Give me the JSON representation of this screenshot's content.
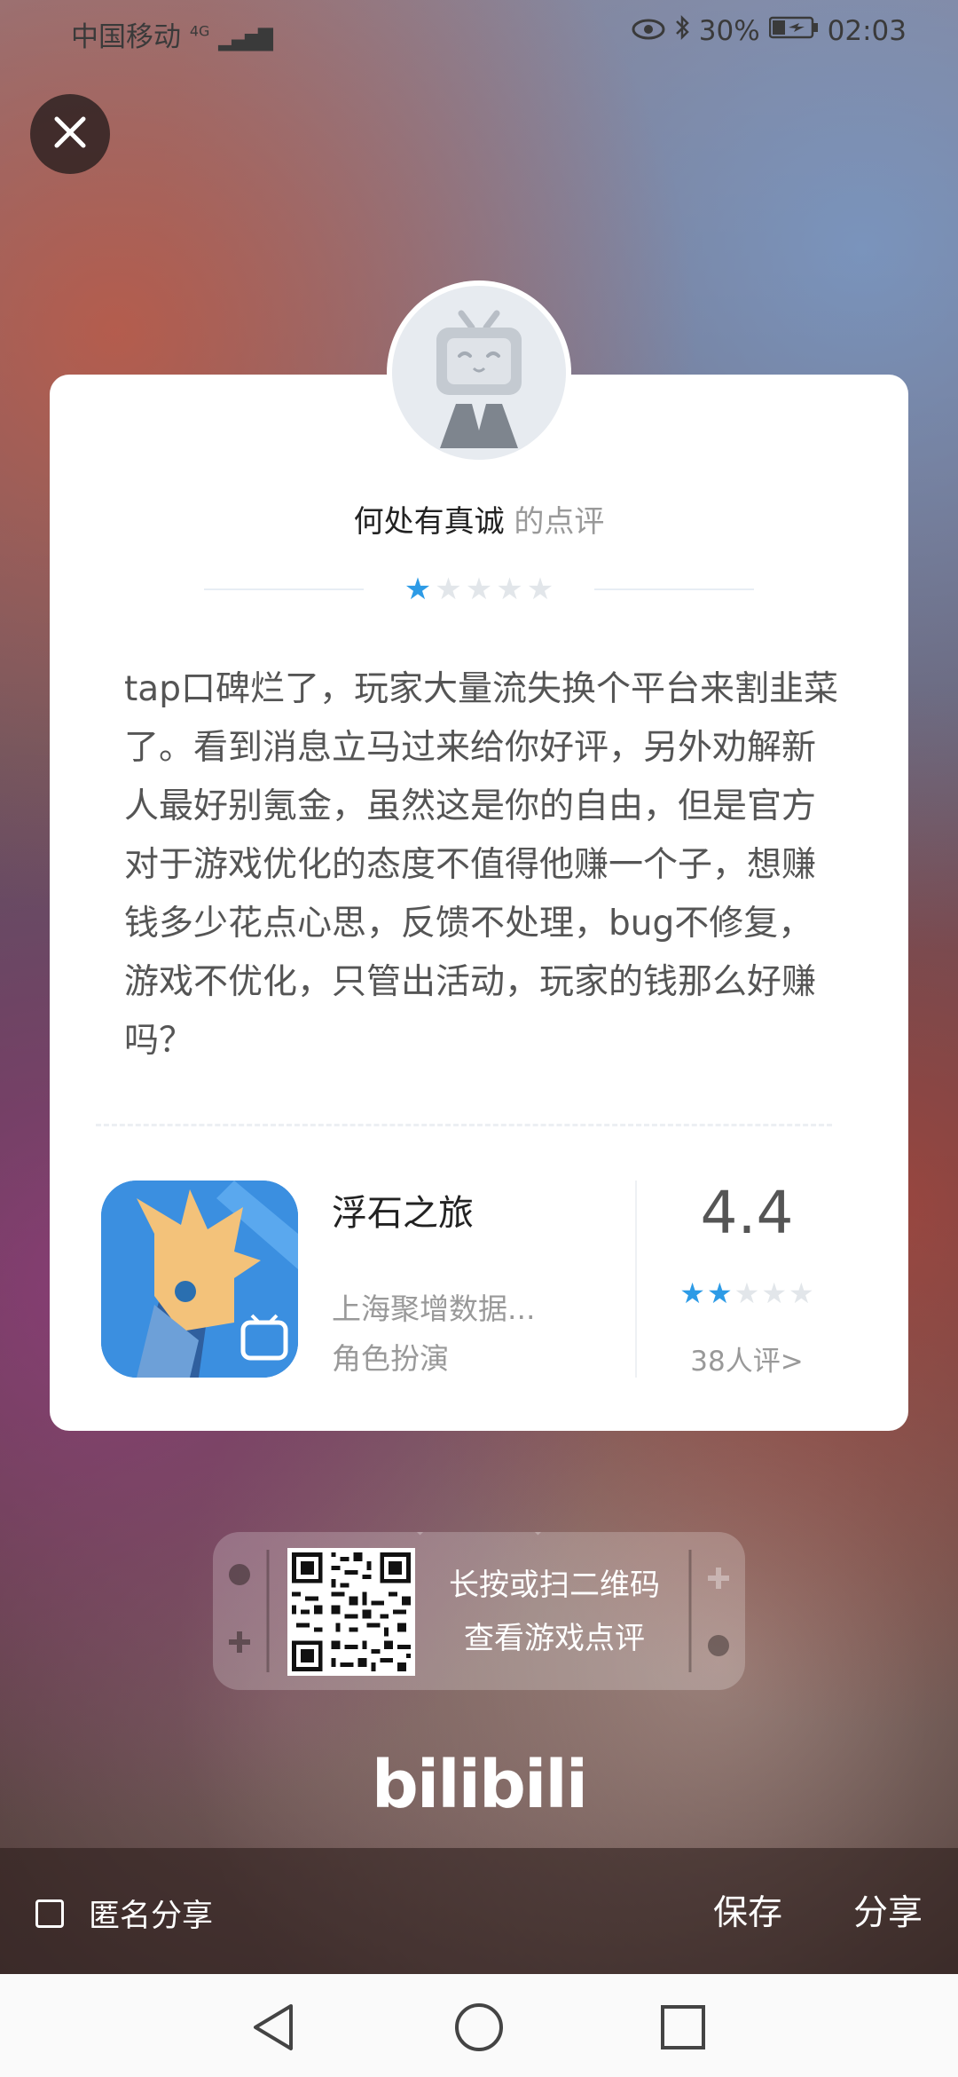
{
  "status_bar": {
    "carrier": "中国移动",
    "network": "4G",
    "battery": "30%",
    "time": "02:03"
  },
  "card": {
    "reviewer_name": "何处有真诚",
    "reviewer_suffix": "的点评",
    "rating": 1,
    "rating_max": 5,
    "review_text": "tap口碑烂了，玩家大量流失换个平台来割韭菜了。看到消息立马过来给你好评，另外劝解新人最好别氪金，虽然这是你的自由，但是官方对于游戏优化的态度不值得他赚一个子，想赚钱多少花点心思，反馈不处理，bug不修复，游戏不优化，只管出活动，玩家的钱那么好赚吗？"
  },
  "game": {
    "name": "浮石之旅",
    "developer": "上海聚增数据...",
    "category": "角色扮演",
    "score": "4.4",
    "score_stars": 2,
    "review_count": "38人评>"
  },
  "qr": {
    "line1": "长按或扫二维码",
    "line2": "查看游戏点评"
  },
  "brand": "bilibili",
  "action_bar": {
    "anonymous_label": "匿名分享",
    "save_label": "保存",
    "share_label": "分享"
  },
  "colors": {
    "accent": "#2d9be6",
    "star_off": "#e2e6ea"
  },
  "icons": [
    "close-icon",
    "eye-icon",
    "bluetooth-icon",
    "battery-icon",
    "back-icon",
    "home-icon",
    "recents-icon"
  ]
}
